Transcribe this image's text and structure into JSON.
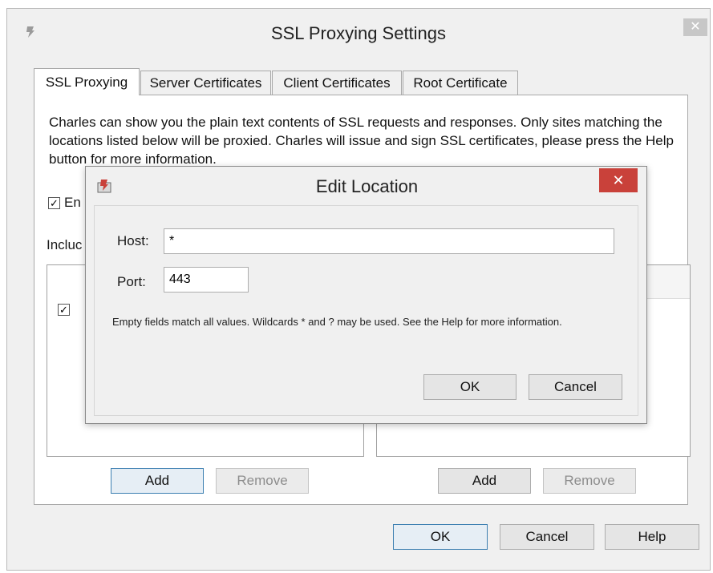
{
  "main": {
    "title": "SSL Proxying Settings",
    "close_glyph": "✕",
    "app_icon": "charles-app-icon",
    "tabs": [
      {
        "label": "SSL Proxying",
        "active": true
      },
      {
        "label": "Server Certificates",
        "active": false
      },
      {
        "label": "Client Certificates",
        "active": false
      },
      {
        "label": "Root Certificate",
        "active": false
      }
    ],
    "description": "Charles can show you the plain text contents of SSL requests and responses. Only sites matching the locations listed below will be proxied. Charles will issue and sign SSL certificates, please press the Help button for more information.",
    "enable_label": "En",
    "include_label": "Incluc",
    "left_add": "Add",
    "left_remove": "Remove",
    "right_add": "Add",
    "right_remove": "Remove",
    "ok": "OK",
    "cancel": "Cancel",
    "help": "Help"
  },
  "edit_location": {
    "title": "Edit Location",
    "close_glyph": "✕",
    "host_label": "Host:",
    "host_value": "*",
    "port_label": "Port:",
    "port_value": "443",
    "hint": "Empty fields match all values. Wildcards * and ? may be used. See the Help for more information.",
    "ok": "OK",
    "cancel": "Cancel"
  },
  "colors": {
    "close_active": "#c9413a",
    "close_inactive": "#c7c7c7",
    "default_button_border": "#3c7fb1"
  }
}
